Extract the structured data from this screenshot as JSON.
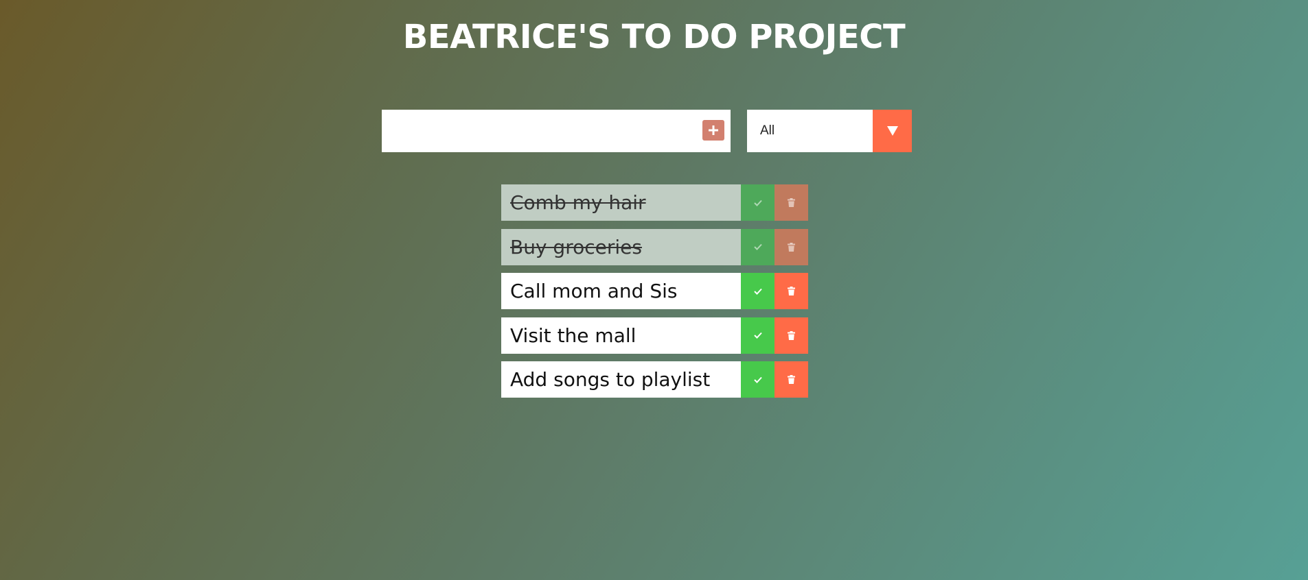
{
  "header": {
    "title": "BEATRICE'S TO DO PROJECT"
  },
  "form": {
    "input_value": "",
    "input_placeholder": "",
    "add_icon": "plus-icon",
    "filter_selected": "All",
    "filter_icon": "chevron-down-icon"
  },
  "todos": [
    {
      "text": "Comb my hair",
      "completed": true
    },
    {
      "text": "Buy groceries",
      "completed": true
    },
    {
      "text": "Call mom and Sis",
      "completed": false
    },
    {
      "text": "Visit the mall",
      "completed": false
    },
    {
      "text": "Add songs to playlist",
      "completed": false
    }
  ],
  "colors": {
    "accent": "#ff6b47",
    "complete": "#47c94b",
    "add_button": "#d2806f"
  }
}
